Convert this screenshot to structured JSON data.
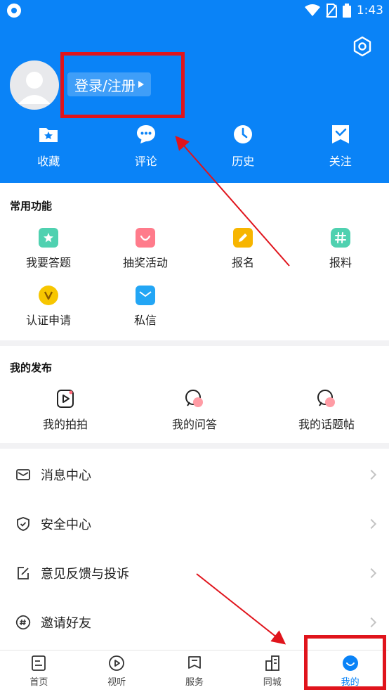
{
  "status_bar": {
    "time": "1:43"
  },
  "header": {
    "login_label": "登录/注册",
    "quick_actions": [
      {
        "label": "收藏",
        "icon": "favorites-folder-icon"
      },
      {
        "label": "评论",
        "icon": "comment-bubble-icon"
      },
      {
        "label": "历史",
        "icon": "history-clock-icon"
      },
      {
        "label": "关注",
        "icon": "follow-bookmark-icon"
      }
    ]
  },
  "common_functions": {
    "title": "常用功能",
    "items": [
      {
        "label": "我要答题",
        "icon": "quiz-star-icon",
        "color": "#4fd1b0"
      },
      {
        "label": "抽奖活动",
        "icon": "lottery-gift-icon",
        "color": "#ff7b8b"
      },
      {
        "label": "报名",
        "icon": "signup-pencil-icon",
        "color": "#f7b500"
      },
      {
        "label": "报料",
        "icon": "hashtag-icon",
        "color": "#4fd1b0"
      },
      {
        "label": "认证申请",
        "icon": "verify-v-icon",
        "color": "#f7c600"
      },
      {
        "label": "私信",
        "icon": "mail-icon",
        "color": "#23a6f5"
      }
    ]
  },
  "my_posts": {
    "title": "我的发布",
    "items": [
      {
        "label": "我的拍拍",
        "icon": "video-play-icon"
      },
      {
        "label": "我的问答",
        "icon": "qa-bubbles-icon"
      },
      {
        "label": "我的话题帖",
        "icon": "topic-bubbles-icon"
      }
    ]
  },
  "menu": [
    {
      "label": "消息中心",
      "icon": "message-envelope-icon"
    },
    {
      "label": "安全中心",
      "icon": "security-shield-icon"
    },
    {
      "label": "意见反馈与投诉",
      "icon": "feedback-edit-icon"
    },
    {
      "label": "邀请好友",
      "icon": "invite-hashtag-icon"
    }
  ],
  "tabbar": [
    {
      "label": "首页",
      "icon": "home-doc-icon",
      "active": false
    },
    {
      "label": "视听",
      "icon": "play-circle-icon",
      "active": false
    },
    {
      "label": "服务",
      "icon": "service-flag-icon",
      "active": false
    },
    {
      "label": "同城",
      "icon": "city-building-icon",
      "active": false
    },
    {
      "label": "我的",
      "icon": "profile-smile-icon",
      "active": true
    }
  ],
  "colors": {
    "brand": "#0a83f7",
    "annotation": "#e0141c"
  }
}
